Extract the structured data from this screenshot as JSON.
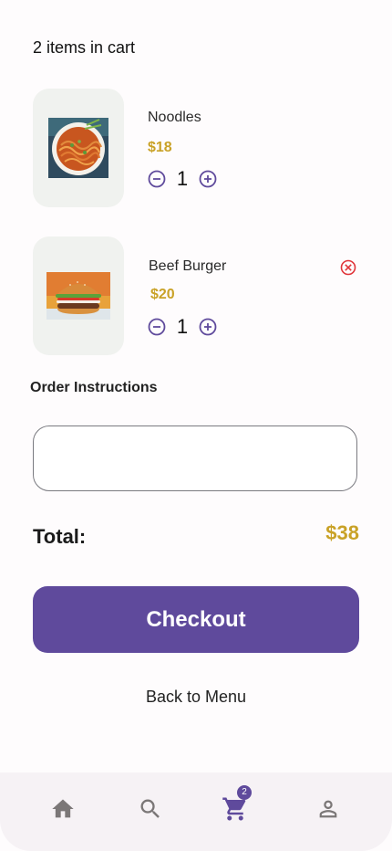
{
  "cart": {
    "summary": "2 items in cart",
    "items": [
      {
        "name": "Noodles",
        "price": "$18",
        "quantity": "1",
        "image": "noodles-bowl"
      },
      {
        "name": "Beef Burger",
        "price": "$20",
        "quantity": "1",
        "image": "beef-burger"
      }
    ]
  },
  "instructions": {
    "label": "Order Instructions",
    "value": ""
  },
  "total": {
    "label": "Total:",
    "value": "$38"
  },
  "checkout": {
    "label": "Checkout"
  },
  "back": {
    "label": "Back to Menu"
  },
  "nav": {
    "items": [
      "home-icon",
      "search-icon",
      "cart-icon",
      "person-icon"
    ],
    "cart_badge": "2"
  },
  "colors": {
    "primary": "#5f4a9c",
    "price": "#c9a227",
    "remove": "#e0353a",
    "nav_inactive": "#7b7777"
  }
}
